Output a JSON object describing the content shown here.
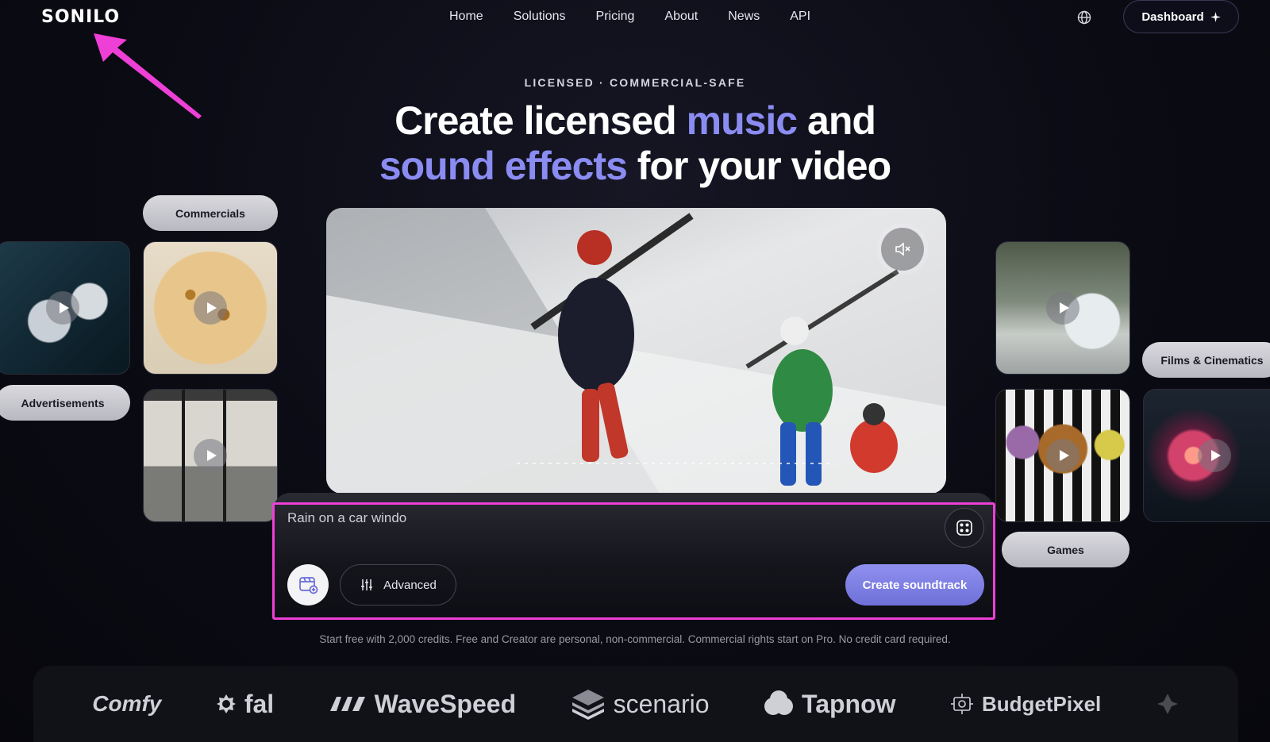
{
  "brand": {
    "logo_text": "SONILO"
  },
  "nav": {
    "items": [
      {
        "label": "Home"
      },
      {
        "label": "Solutions"
      },
      {
        "label": "Pricing"
      },
      {
        "label": "About"
      },
      {
        "label": "News"
      },
      {
        "label": "API"
      }
    ],
    "globe_icon": "globe-icon",
    "dashboard_label": "Dashboard",
    "dashboard_icon": "sparkle-icon"
  },
  "hero": {
    "eyebrow": "LICENSED · COMMERCIAL-SAFE",
    "line1_a": "Create licensed ",
    "line1_accent": "music",
    "line1_b": " and",
    "line2_accent": "sound effects",
    "line2_b": " for your video"
  },
  "categories": {
    "commercials": "Commercials",
    "advertisements": "Advertisements",
    "films": "Films & Cinematics",
    "games": "Games"
  },
  "prompt": {
    "value": "Rain on a car windo",
    "randomize_icon": "dice-icon",
    "upload_icon": "video-upload-icon",
    "advanced_label": "Advanced",
    "advanced_icon": "sliders-icon",
    "create_label": "Create soundtrack"
  },
  "disclaimer": "Start free with 2,000 credits. Free and Creator are personal, non-commercial. Commercial rights start on Pro. No credit card required.",
  "partners": [
    {
      "name": "Comfy"
    },
    {
      "name": "fal"
    },
    {
      "name": "WaveSpeed"
    },
    {
      "name": "scenario"
    },
    {
      "name": "Tapnow"
    },
    {
      "name": "BudgetPixel"
    }
  ],
  "colors": {
    "accent": "#8b8cf2",
    "highlight": "#ee3fd6",
    "background": "#0b0b14"
  }
}
